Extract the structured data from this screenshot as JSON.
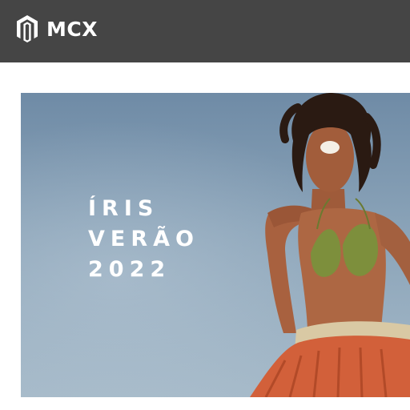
{
  "header": {
    "brand_name": "MCX",
    "logo_icon": "magento-logo-icon",
    "background_color": "#454545"
  },
  "hero": {
    "title_lines": [
      "ÍRIS",
      "VERÃO",
      "2022"
    ],
    "image_subject": "model-summer-collection-image",
    "text_color": "#ffffff"
  }
}
